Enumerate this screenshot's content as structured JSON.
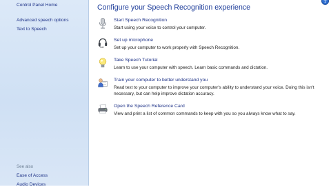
{
  "sidebar": {
    "home_link": "Control Panel Home",
    "links": [
      {
        "label": "Advanced speech options"
      },
      {
        "label": "Text to Speech"
      }
    ],
    "see_also_heading": "See also",
    "see_also": [
      {
        "label": "Ease of Access"
      },
      {
        "label": "Audio Devices"
      }
    ]
  },
  "main": {
    "title": "Configure your Speech Recognition experience",
    "help_label": "?",
    "items": [
      {
        "icon": "microphone-icon",
        "title": "Start Speech Recognition",
        "desc": "Start using your voice to control your computer."
      },
      {
        "icon": "headset-icon",
        "title": "Set up microphone",
        "desc": "Set up your computer to work properly with Speech Recognition."
      },
      {
        "icon": "lightbulb-icon",
        "title": "Take Speech Tutorial",
        "desc": "Learn to use your computer with speech.  Learn basic commands and dictation."
      },
      {
        "icon": "user-training-icon",
        "title": "Train your computer to better understand you",
        "desc": "Read text to your computer to improve your computer's ability to understand your voice. Doing this isn't necessary, but can help improve dictation accuracy."
      },
      {
        "icon": "printer-icon",
        "title": "Open the Speech Reference Card",
        "desc": "View and print a list of common commands to keep with you so you always know what to say."
      }
    ]
  },
  "colors": {
    "link": "#1e3287",
    "title": "#1e3d9a",
    "sidebar_bg": "#d6e5f7"
  }
}
